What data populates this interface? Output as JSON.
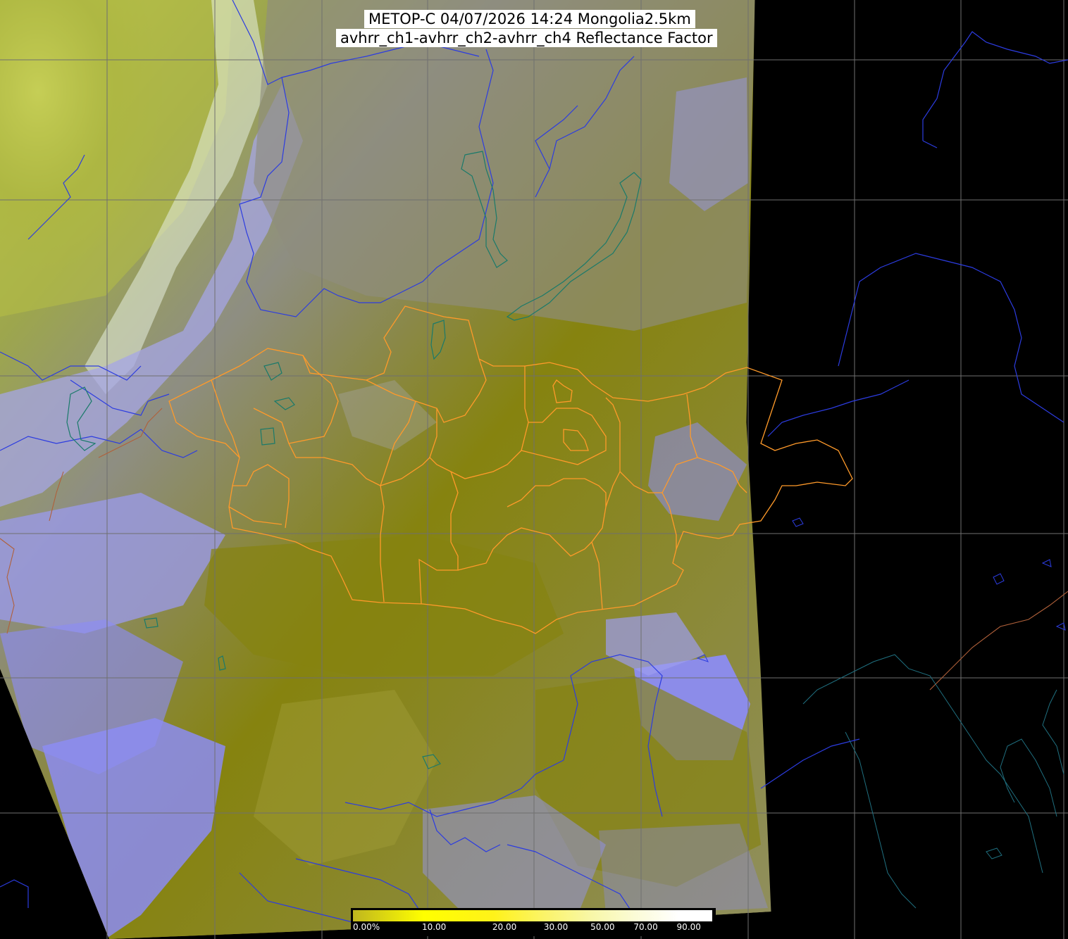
{
  "title": {
    "line1": "METOP-C 04/07/2026 14:24 Mongolia2.5km",
    "line2": "avhrr_ch1-avhrr_ch2-avhrr_ch4 Reflectance Factor"
  },
  "colors": {
    "background": "#000000",
    "cloud": "#8c8cf2",
    "surface": "#86830f",
    "surface_light": "#a39f30",
    "grey_band": "#8f8e7e",
    "snow_green": "#b7c23e",
    "grid": "#6f6f6f",
    "admin_border": "#ff9a2a",
    "national_border": "#b0603a",
    "river": "#2c3ce0",
    "lake": "#1a7a6a",
    "coast_dark": "#1f6f7f"
  },
  "colorbar": {
    "labels": [
      "0.00%",
      "10.00",
      "20.00",
      "30.00",
      "50.00",
      "70.00",
      "90.00"
    ],
    "stops": [
      0,
      10,
      20,
      30,
      50,
      70,
      90,
      100
    ],
    "colors": [
      "#bfb61e",
      "#ffff00",
      "#fff21a",
      "#fbf46a",
      "#f8f7a8",
      "#fbfbd6",
      "#ffffff"
    ]
  },
  "map": {
    "grid_lon_pixels_note": "",
    "swath": "visible"
  }
}
